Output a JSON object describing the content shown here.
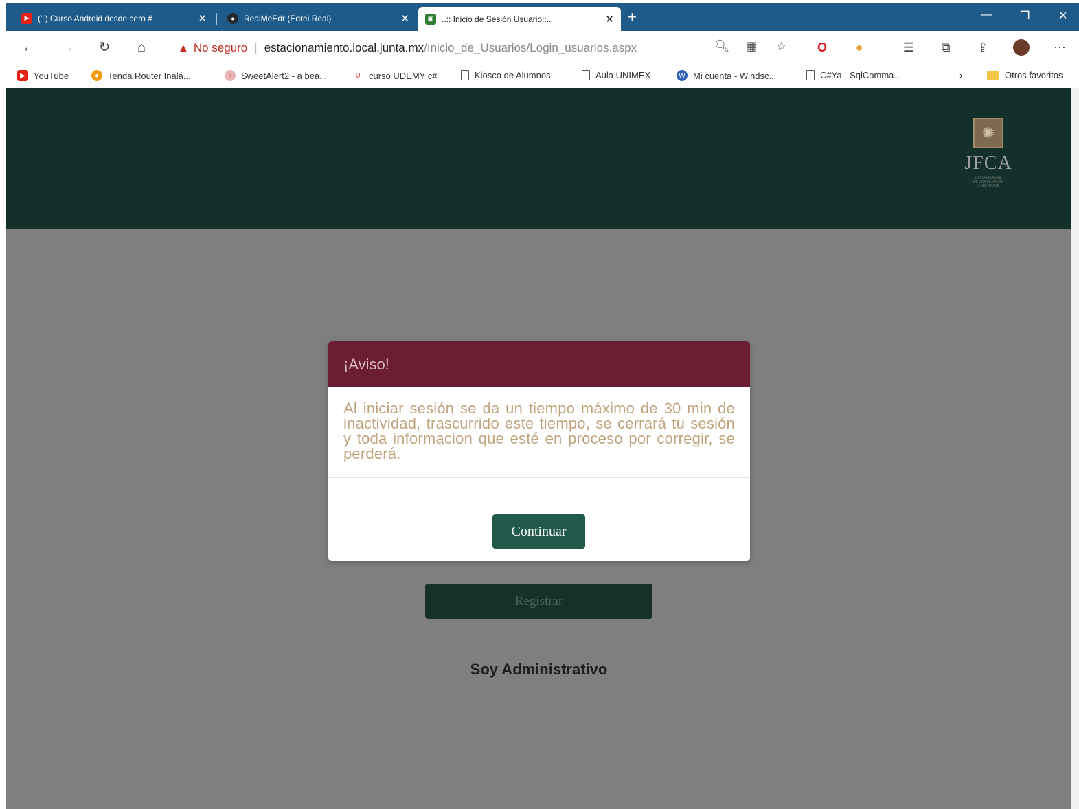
{
  "browser": {
    "tabs": [
      {
        "title": "(1) Curso Android desde cero #",
        "favicon": "youtube-icon",
        "color": "#e62117"
      },
      {
        "title": "RealMeEdr (Edrei Real)",
        "favicon": "github-icon",
        "color": "#24292e"
      },
      {
        "title": "..:: Inicio de Sesión Usuario::..",
        "favicon": "save-icon",
        "color": "#2e7d32"
      }
    ],
    "address": {
      "security_label": "No seguro",
      "url_host": "estacionamiento.local.junta.mx",
      "url_path": "/Inicio_de_Usuarios/Login_usuarios.aspx"
    },
    "bookmarks": [
      {
        "label": "YouTube",
        "icon": "youtube-icon"
      },
      {
        "label": "Tenda Router Inalá...",
        "icon": "tenda-icon"
      },
      {
        "label": "SweetAlert2 - a bea...",
        "icon": "sweetalert-icon"
      },
      {
        "label": "curso UDEMY c#",
        "icon": "udemy-icon"
      },
      {
        "label": "Kiosco de Alumnos",
        "icon": "page-icon"
      },
      {
        "label": "Aula UNIMEX",
        "icon": "page-icon"
      },
      {
        "label": "Mi cuenta - Windsc...",
        "icon": "windscribe-icon"
      },
      {
        "label": "C#Ya - SqlComma...",
        "icon": "page-icon"
      }
    ],
    "other_favorites": "Otros favoritos"
  },
  "header": {
    "logo_text": "JFCA",
    "logo_subtext": [
      "JUNTA FEDERAL",
      "DE CONCILIACIÓN",
      "Y ARBITRAJE"
    ]
  },
  "page": {
    "register_button": "Registrar",
    "admin_link": "Soy Administrativo"
  },
  "modal": {
    "title": "¡Aviso!",
    "message": "Al iniciar sesión se da un tiempo máximo de 30 min de inactividad, trascurrido este tiempo, se cerrará tu sesión y toda informacion que esté en proceso por corregir, se perderá.",
    "continue_button": "Continuar"
  },
  "colors": {
    "header_bg": "#14302a",
    "modal_header": "#6b1d33",
    "accent_green": "#21594a",
    "message_text": "#c1a37c"
  }
}
